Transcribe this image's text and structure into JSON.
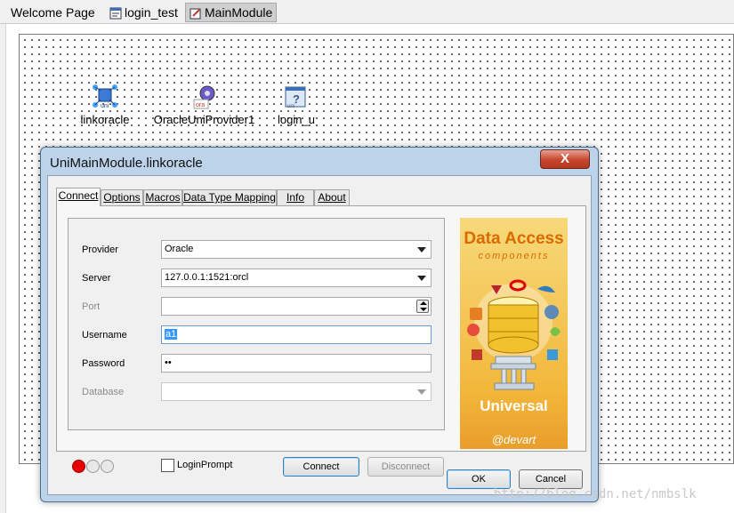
{
  "ide_tabs": [
    {
      "label": "Welcome Page"
    },
    {
      "label": "login_test"
    },
    {
      "label": "MainModule"
    }
  ],
  "components": [
    {
      "label": "linkoracle",
      "icon": "uni-connection-icon"
    },
    {
      "label": "OracleUniProvider1",
      "icon": "oracle-provider-icon"
    },
    {
      "label": "login_u",
      "icon": "uni-query-icon"
    }
  ],
  "dialog": {
    "title": "UniMainModule.linkoracle",
    "close": "X",
    "tabs": [
      {
        "label": "Connect"
      },
      {
        "label": "Options"
      },
      {
        "label": "Macros"
      },
      {
        "label": "Data Type Mapping"
      },
      {
        "label": "Info"
      },
      {
        "label": "About"
      }
    ],
    "form": {
      "provider_label": "Provider",
      "provider_value": "Oracle",
      "server_label": "Server",
      "server_value": "127.0.0.1:1521:orcl",
      "port_label": "Port",
      "port_value": "",
      "username_label": "Username",
      "username_value": "a1",
      "password_label": "Password",
      "password_value": "••",
      "database_label": "Database",
      "database_value": ""
    },
    "promo": {
      "title": "Data Access",
      "subtitle": "components",
      "product": "Universal",
      "brand": "@devart"
    },
    "login_prompt_label": "LoginPrompt",
    "login_prompt_checked": false,
    "connect_label": "Connect",
    "disconnect_label": "Disconnect",
    "ok_label": "OK",
    "cancel_label": "Cancel"
  },
  "watermark": "http://blog.csdn.net/nmbslk",
  "colors": {
    "dialog_frame": "#bcd3ea",
    "close_button": "#c6452d",
    "promo_bg": "#f2b73b",
    "status_led": "#e60000",
    "selection": "#3399ff"
  }
}
